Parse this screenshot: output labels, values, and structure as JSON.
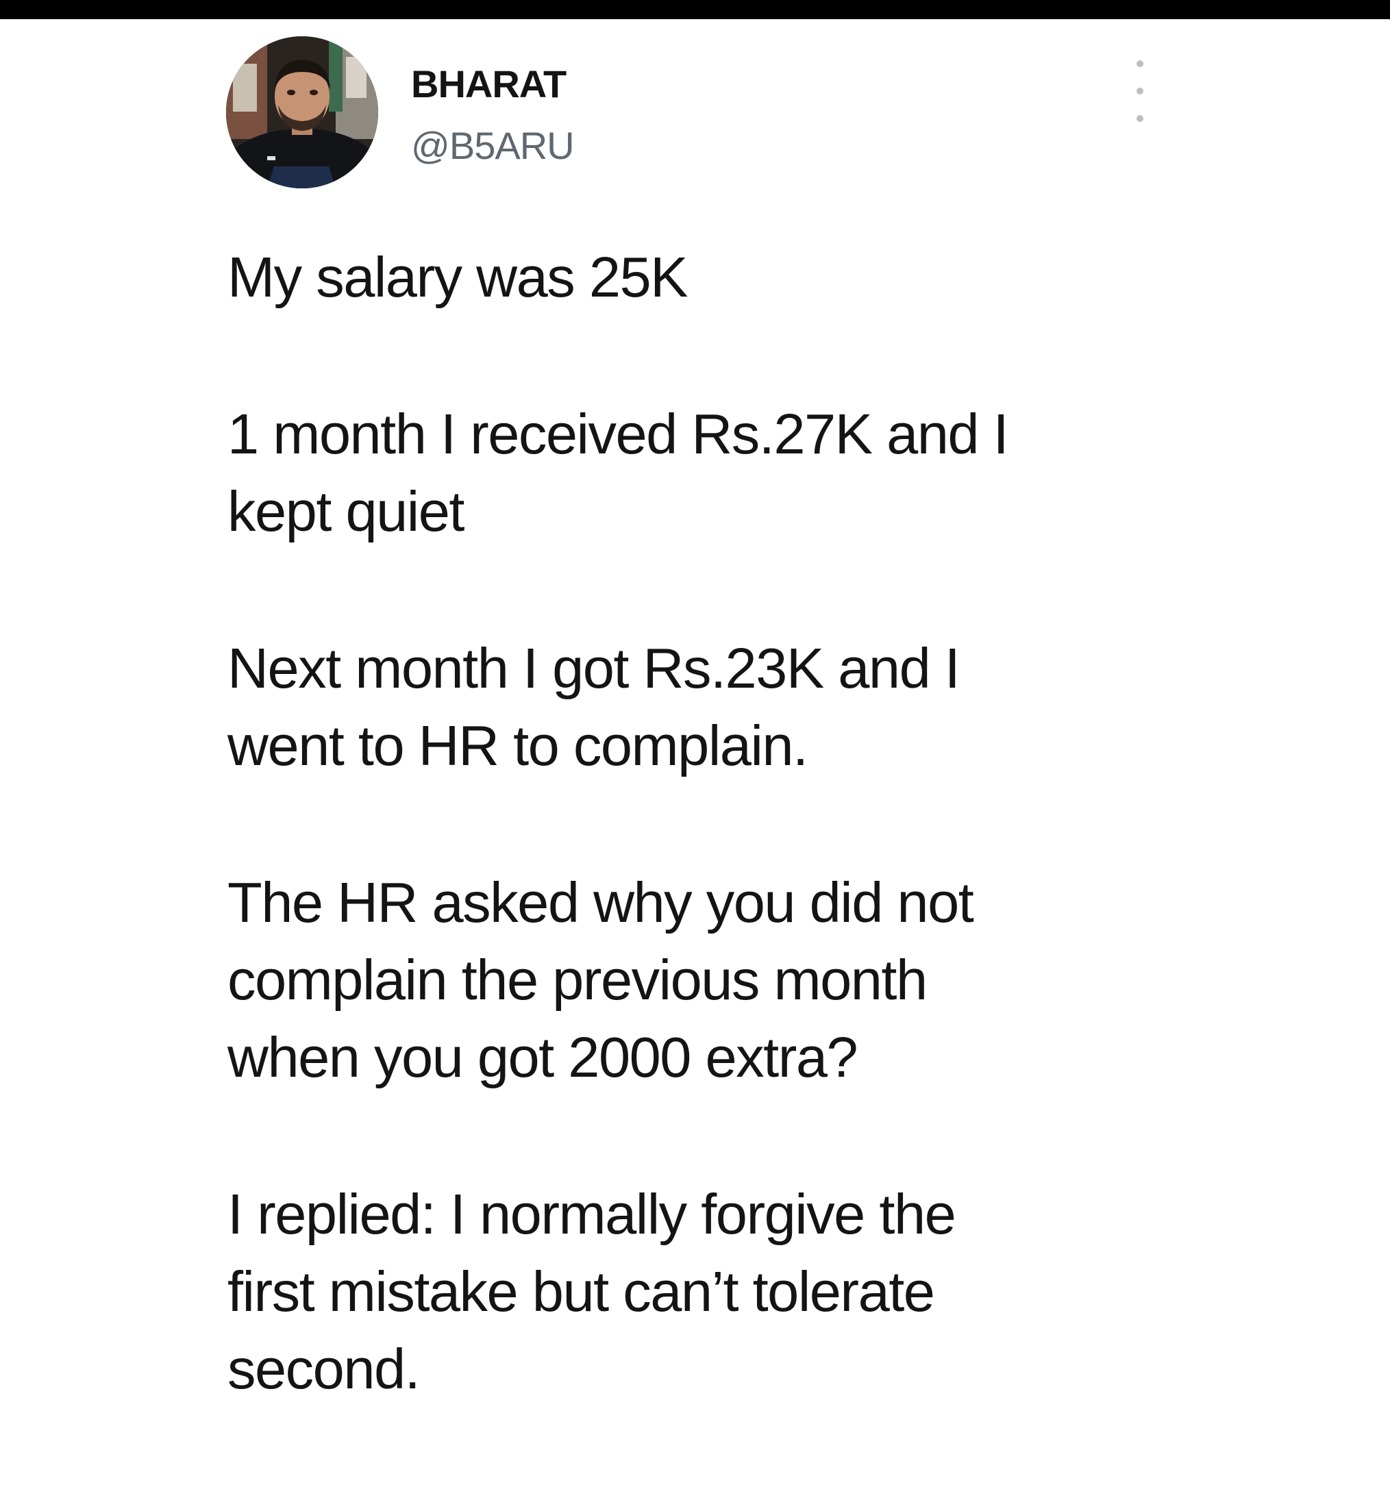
{
  "tweet": {
    "author": {
      "name": "BHARAT",
      "handle": "@B5ARU",
      "avatar": "profile-photo"
    },
    "more_icon": "vertical-ellipsis-icon",
    "paragraphs": [
      [
        "My salary was 25K"
      ],
      [
        "1 month I received Rs.27K and I",
        "kept quiet"
      ],
      [
        "Next month I got Rs.23K and I",
        "went to HR to complain."
      ],
      [
        "The HR asked why you did not",
        "complain the previous month",
        "when you got 2000 extra?"
      ],
      [
        "I replied: I normally forgive the",
        "first mistake but can’t tolerate",
        "second."
      ]
    ]
  },
  "colors": {
    "background": "#ffffff",
    "top_bar": "#000000",
    "text": "#141414",
    "handle": "#5f6870",
    "dots": "#b9bfc4"
  }
}
